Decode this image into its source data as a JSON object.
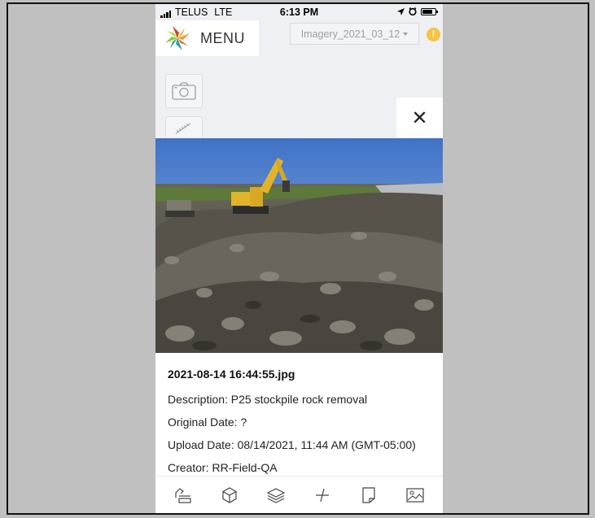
{
  "status_bar": {
    "carrier": "TELUS",
    "network": "LTE",
    "time": "6:13 PM"
  },
  "menu": {
    "label": "MENU"
  },
  "imagery_select": {
    "value": "Imagery_2021_03_12"
  },
  "alert_badge": {
    "text": "!"
  },
  "close_button": {
    "glyph": "✕"
  },
  "photo_details": {
    "filename": "2021-08-14 16:44:55.jpg",
    "description": "Description: P25 stockpile rock removal",
    "original_date": "Original Date: ?",
    "upload_date": "Upload Date: 08/14/2021, 11:44 AM (GMT-05:00)",
    "creator": "Creator: RR-Field-QA"
  },
  "toolbar": {
    "icons": [
      "draw-tool-icon",
      "3d-cube-icon",
      "layers-icon",
      "compass-icon",
      "document-icon",
      "image-icon"
    ]
  },
  "colors": {
    "accent_yellow": "#f4c542",
    "logo_green": "#8cc63f",
    "logo_orange": "#f39c32",
    "logo_red": "#d0452f",
    "logo_teal": "#2f9fa8"
  }
}
